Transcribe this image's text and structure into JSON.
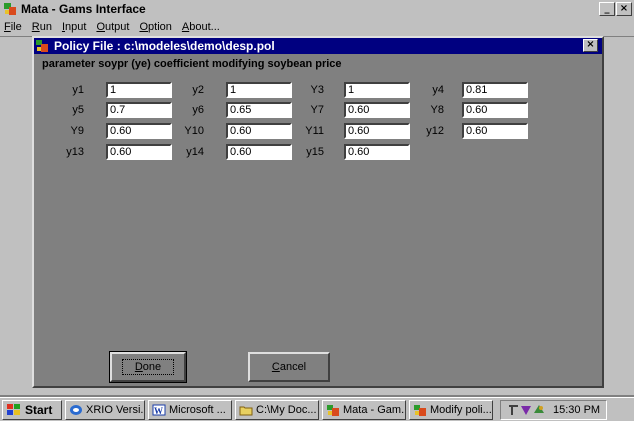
{
  "app": {
    "title": "Mata - Gams Interface",
    "window_buttons": [
      "_",
      "×"
    ],
    "menu": [
      {
        "u": "F",
        "rest": "ile"
      },
      {
        "u": "R",
        "rest": "un"
      },
      {
        "u": "I",
        "rest": "nput"
      },
      {
        "u": "O",
        "rest": "utput"
      },
      {
        "u": "O",
        "rest": "ption",
        "pre": "",
        "full": "Option"
      },
      {
        "u": "A",
        "rest": "bout..."
      }
    ]
  },
  "dialog": {
    "title": "Policy File : c:\\modeles\\demo\\desp.pol",
    "close": "×",
    "subtitle": "parameter soypr (ye) coefficient modifying soybean price",
    "fields": [
      {
        "label": "y1",
        "value": "1"
      },
      {
        "label": "y2",
        "value": "1"
      },
      {
        "label": "Y3",
        "value": "1"
      },
      {
        "label": "y4",
        "value": "0.81"
      },
      {
        "label": "y5",
        "value": "0.7"
      },
      {
        "label": "y6",
        "value": "0.65"
      },
      {
        "label": "Y7",
        "value": "0.60"
      },
      {
        "label": "Y8",
        "value": "0.60"
      },
      {
        "label": "Y9",
        "value": "0.60"
      },
      {
        "label": "Y10",
        "value": "0.60"
      },
      {
        "label": "Y11",
        "value": "0.60"
      },
      {
        "label": "y12",
        "value": "0.60"
      },
      {
        "label": "y13",
        "value": "0.60"
      },
      {
        "label": "y14",
        "value": "0.60"
      },
      {
        "label": "y15",
        "value": "0.60"
      }
    ],
    "done_label": "Done",
    "cancel_label": "Cancel"
  },
  "taskbar": {
    "start_label": "Start",
    "items": [
      {
        "label": "XRIO Versi...",
        "icon": "xrio-icon"
      },
      {
        "label": "Microsoft ...",
        "icon": "word-icon"
      },
      {
        "label": "C:\\My Doc...",
        "icon": "folder-icon"
      },
      {
        "label": "Mata - Gam...",
        "icon": "mata-icon"
      },
      {
        "label": "Modify poli...",
        "icon": "mata-icon"
      }
    ],
    "clock": "15:30 PM"
  },
  "colors": {
    "title_bar": "#000080",
    "dialog_bg": "#808080",
    "face": "#c0c0c0"
  }
}
